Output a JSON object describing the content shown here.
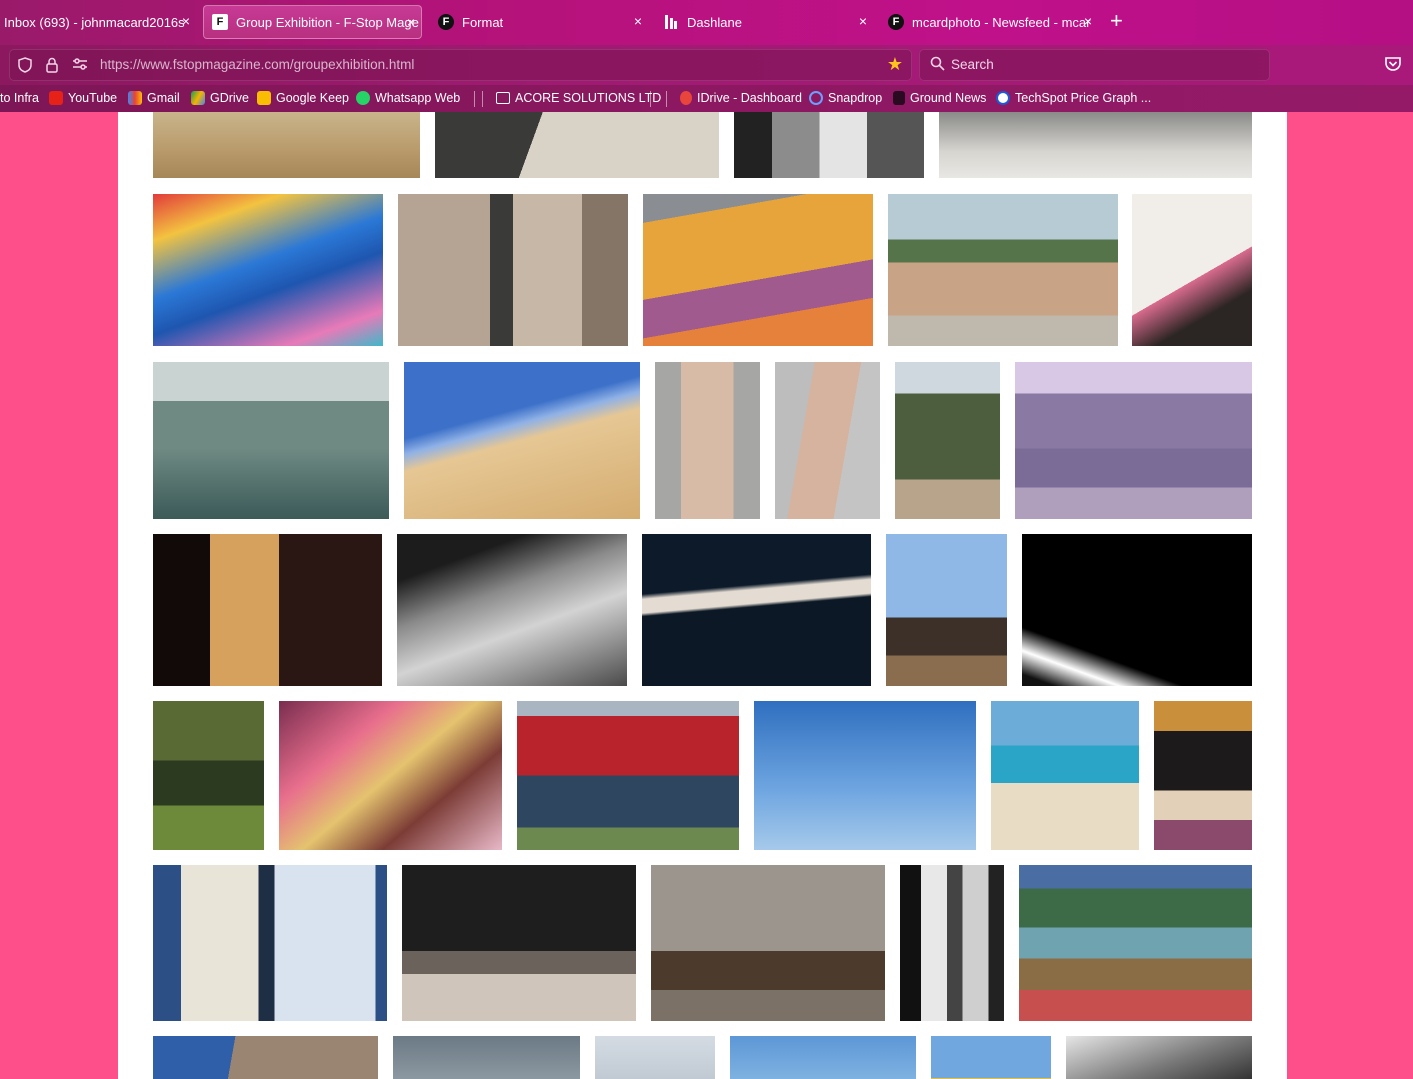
{
  "browser": {
    "tabs": [
      {
        "title": "Inbox (693) - johnmacard2016s",
        "favicon": "gmail-icon"
      },
      {
        "title": "Group Exhibition - F-Stop Mage",
        "favicon": "fstop-icon",
        "active": true
      },
      {
        "title": "Format",
        "favicon": "format-icon"
      },
      {
        "title": "Dashlane",
        "favicon": "dashlane-icon"
      },
      {
        "title": "mcardphoto - Newsfeed - mcar",
        "favicon": "format-icon"
      }
    ],
    "new_tab_label": "+",
    "close_label": "×",
    "url": "https://www.fstopmagazine.com/groupexhibition.html",
    "search_placeholder": "Search",
    "bookmarks": [
      {
        "label": "to Infra",
        "icon": "none"
      },
      {
        "label": "YouTube",
        "icon": "youtube-icon"
      },
      {
        "label": "Gmail",
        "icon": "gmail-icon"
      },
      {
        "label": "GDrive",
        "icon": "gdrive-icon"
      },
      {
        "label": "Google Keep",
        "icon": "keep-icon"
      },
      {
        "label": "Whatsapp Web",
        "icon": "whatsapp-icon"
      },
      {
        "label": "ACORE SOLUTIONS LTD",
        "icon": "folder-icon"
      },
      {
        "label": "IDrive - Dashboard",
        "icon": "idrive-icon"
      },
      {
        "label": "Snapdrop",
        "icon": "snapdrop-icon"
      },
      {
        "label": "Ground News",
        "icon": "groundnews-icon"
      },
      {
        "label": "TechSpot Price Graph ...",
        "icon": "techspot-icon"
      }
    ]
  },
  "colors": {
    "page_background": "#ff4f8b",
    "content_background": "#ffffff",
    "star": "#ffc51c"
  },
  "gallery": {
    "rows": 8
  }
}
